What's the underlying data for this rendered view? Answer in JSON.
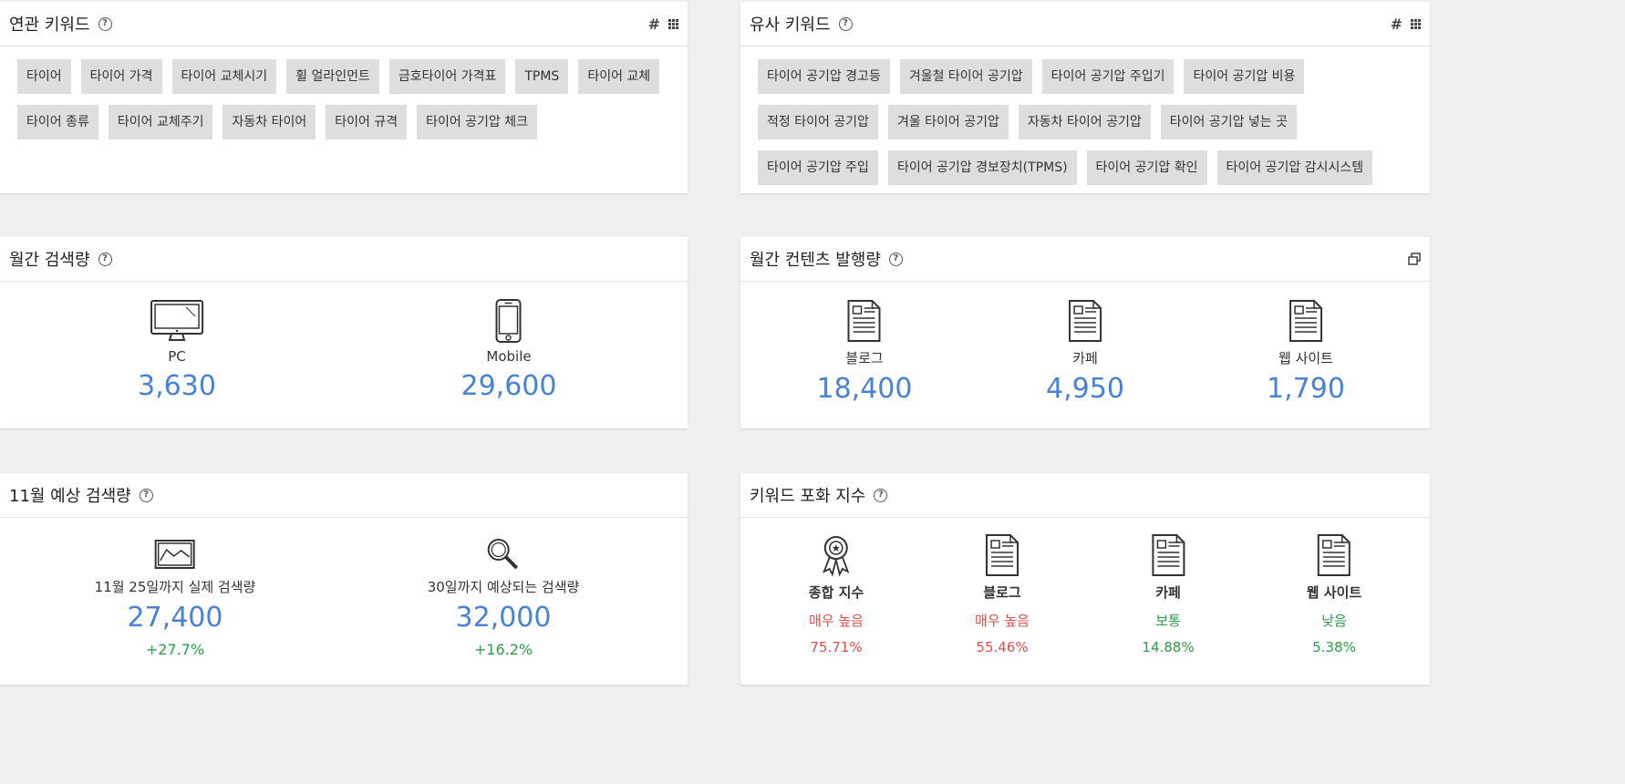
{
  "related": {
    "title": "연관 키워드",
    "keywords": [
      "타이어",
      "타이어 가격",
      "타이어 교체시기",
      "휠 얼라인먼트",
      "금호타이어 가격표",
      "TPMS",
      "타이어 교체",
      "타이어 종류",
      "타이어 교체주기",
      "자동차 타이어",
      "타이어 규격",
      "타이어 공기압 체크"
    ]
  },
  "similar": {
    "title": "유사 키워드",
    "keywords": [
      "타이어 공기압 경고등",
      "겨울철 타이어 공기압",
      "타이어 공기압 주입기",
      "타이어 공기압 비용",
      "적정 타이어 공기압",
      "겨울 타이어 공기압",
      "자동차 타이어 공기압",
      "타이어 공기압 넣는 곳",
      "타이어 공기압 주입",
      "타이어 공기압 경보장치(TPMS)",
      "타이어 공기압 확인",
      "타이어 공기압 감시시스템"
    ]
  },
  "monthly_search": {
    "title": "월간 검색량",
    "pc": {
      "label": "PC",
      "value": "3,630",
      "icon": "monitor-icon"
    },
    "mobile": {
      "label": "Mobile",
      "value": "29,600",
      "icon": "phone-icon"
    }
  },
  "monthly_content": {
    "title": "월간 컨텐츠 발행량",
    "items": [
      {
        "label": "블로그",
        "value": "18,400",
        "icon": "document-icon"
      },
      {
        "label": "카페",
        "value": "4,950",
        "icon": "document-icon"
      },
      {
        "label": "웹 사이트",
        "value": "1,790",
        "icon": "document-icon"
      }
    ]
  },
  "forecast": {
    "title": "11월 예상 검색량",
    "actual": {
      "label": "11월 25일까지 실제 검색량",
      "value": "27,400",
      "change": "+27.7%",
      "icon": "line-chart-icon"
    },
    "expected": {
      "label": "30일까지 예상되는 검색량",
      "value": "32,000",
      "change": "+16.2%",
      "icon": "magnifier-icon"
    }
  },
  "saturation": {
    "title": "키워드 포화 지수",
    "items": [
      {
        "label": "종합 지수",
        "level": "매우 높음",
        "value": "75.71%",
        "icon": "award-icon"
      },
      {
        "label": "블로그",
        "level": "매우 높음",
        "value": "55.46%",
        "icon": "document-icon"
      },
      {
        "label": "카페",
        "level": "보통",
        "value": "14.88%",
        "icon": "document-icon"
      },
      {
        "label": "웹 사이트",
        "level": "낮음",
        "value": "5.38%",
        "icon": "document-icon"
      }
    ]
  },
  "colors": {
    "value_blue": "#4a82d3",
    "high_red": "#d9534f",
    "low_green": "#2e9a4a",
    "chip_bg": "#dedede"
  }
}
